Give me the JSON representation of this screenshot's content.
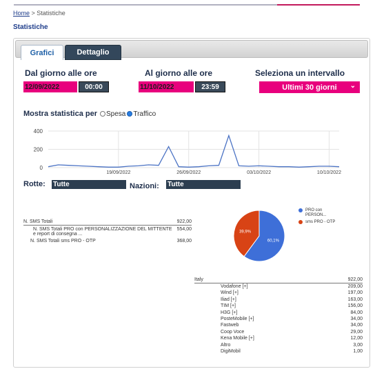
{
  "breadcrumb": {
    "home": "Home",
    "separator": " > ",
    "current": "Statistiche"
  },
  "page_title": "Statistiche",
  "tabs": {
    "grafici": "Grafici",
    "dettaglio": "Dettaglio"
  },
  "period": {
    "from_label": "Dal giorno alle ore",
    "from_date": "12/09/2022",
    "from_time": "00:00",
    "to_label": "Al giorno  alle ore",
    "to_date": "11/10/2022",
    "to_time": "23:59",
    "interval_label": "Seleziona un intervallo",
    "interval_value": "Ultimi 30 giorni"
  },
  "show_stats": {
    "label": "Mostra statistica per",
    "option_spesa": "Spesa",
    "option_traffico": "Traffico",
    "selected": "Traffico"
  },
  "chart_data": {
    "type": "line",
    "y_ticks": [
      "400",
      "200",
      "0"
    ],
    "ylim": [
      0,
      400
    ],
    "x_tick_labels": [
      "19/09/2022",
      "26/09/2022",
      "03/10/2022",
      "10/10/2022"
    ],
    "x": [
      "12/09/2022",
      "13/09/2022",
      "14/09/2022",
      "15/09/2022",
      "16/09/2022",
      "17/09/2022",
      "18/09/2022",
      "19/09/2022",
      "20/09/2022",
      "21/09/2022",
      "22/09/2022",
      "23/09/2022",
      "24/09/2022",
      "25/09/2022",
      "26/09/2022",
      "27/09/2022",
      "28/09/2022",
      "29/09/2022",
      "30/09/2022",
      "01/10/2022",
      "02/10/2022",
      "03/10/2022",
      "04/10/2022",
      "05/10/2022",
      "06/10/2022",
      "07/10/2022",
      "08/10/2022",
      "09/10/2022",
      "10/10/2022",
      "11/10/2022"
    ],
    "values": [
      10,
      30,
      25,
      20,
      15,
      10,
      5,
      5,
      15,
      20,
      30,
      25,
      230,
      10,
      5,
      10,
      20,
      25,
      350,
      20,
      15,
      20,
      15,
      10,
      10,
      5,
      10,
      15,
      15,
      10
    ],
    "grid": true,
    "color": "#4a72c4"
  },
  "filters": {
    "rotte_label": "Rotte:",
    "rotte_value": "Tutte",
    "nazioni_label": "Nazioni:",
    "nazioni_value": "Tutte"
  },
  "sms_table": {
    "total_label": "N. SMS Totali",
    "total_value": "922,00",
    "rows": [
      {
        "label": "N. SMS Totali PRO con PERSONALIZZAZIONE DEL MITTENTE e report di consegna ...",
        "value": "554,00"
      },
      {
        "label": "N. SMS Totali sms PRO - OTP",
        "value": "368,00"
      }
    ]
  },
  "pie_data": {
    "type": "pie",
    "slices": [
      {
        "label": "PRO con PERSON...",
        "value": 60.1,
        "display": "60,1%",
        "color": "#3e6fd8"
      },
      {
        "label": "sms PRO - OTP",
        "value": 39.9,
        "display": "39,9%",
        "color": "#d84315"
      }
    ]
  },
  "nation_table": {
    "nation": "Italy",
    "total": "922,00",
    "operators": [
      {
        "name": "Vodafone [+]",
        "value": "209,00"
      },
      {
        "name": "Wind [+]",
        "value": "197,00"
      },
      {
        "name": "Iliad [+]",
        "value": "163,00"
      },
      {
        "name": "TIM [+]",
        "value": "156,00"
      },
      {
        "name": "H3G [+]",
        "value": "84,00"
      },
      {
        "name": "PosteMobile [+]",
        "value": "34,00"
      },
      {
        "name": "Fastweb",
        "value": "34,00"
      },
      {
        "name": "Coop Voce",
        "value": "29,00"
      },
      {
        "name": "Kena Mobile [+]",
        "value": "12,00"
      },
      {
        "name": "Altro",
        "value": "3,00"
      },
      {
        "name": "DigiMobil",
        "value": "1,00"
      }
    ]
  }
}
